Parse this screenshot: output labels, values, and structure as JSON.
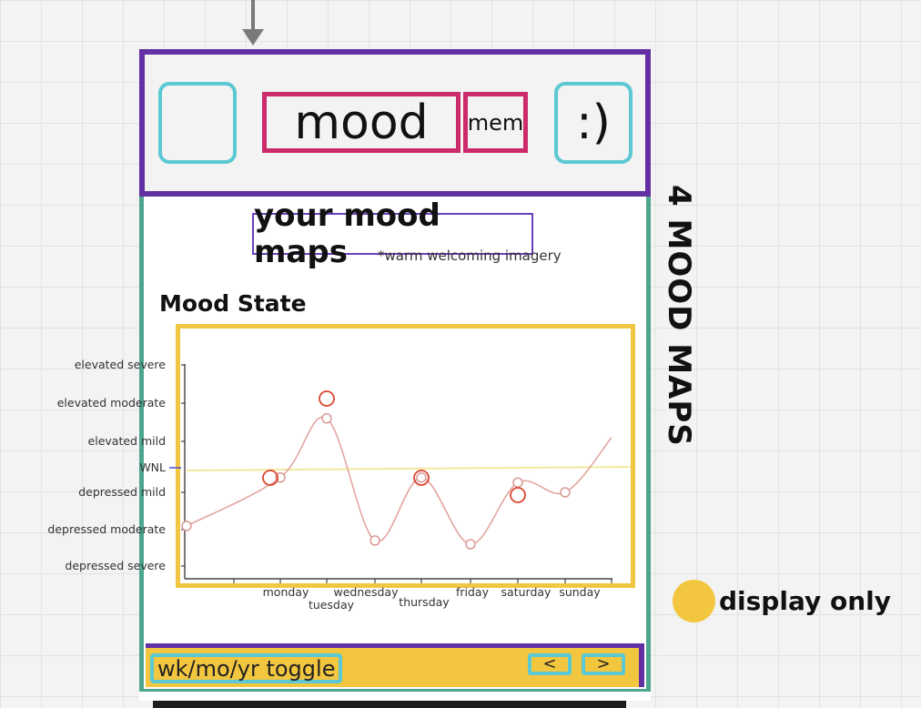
{
  "header": {
    "mood_label": "mood",
    "mem_label": "mem",
    "smile_label": ":)"
  },
  "page": {
    "title": "your mood maps",
    "imagery_note": "*warm welcoming imagery",
    "side_title": "4 MOOD MAPS"
  },
  "chart_heading": "Mood State",
  "chart_data": {
    "type": "line",
    "title": "Mood State",
    "y_categories": [
      "depressed severe",
      "depressed moderate",
      "depressed mild",
      "WNL",
      "elevated mild",
      "elevated moderate",
      "elevated severe"
    ],
    "x": [
      "monday",
      "tuesday",
      "wednesday",
      "thursday",
      "friday",
      "saturday",
      "sunday"
    ],
    "series": [
      {
        "values": [
          {
            "x": "start",
            "y": 1.1
          },
          {
            "x": "monday",
            "y": 2.6
          },
          {
            "x": "tuesday",
            "y": 4.6
          },
          {
            "x": "wednesday",
            "y": 0.7
          },
          {
            "x": "thursday",
            "y": 2.6
          },
          {
            "x": "friday",
            "y": 0.6
          },
          {
            "x": "saturday",
            "y": 2.4
          },
          {
            "x": "sunday",
            "y": 2.0
          },
          {
            "x": "end",
            "y": 4.1
          }
        ],
        "color": "#e3a5a0"
      }
    ],
    "wnl_line": {
      "label": "WNL",
      "color": "#f2ea9c"
    },
    "highlighted_points": [
      "monday",
      "tuesday",
      "thursday",
      "saturday"
    ],
    "highlight_color": "#d9462f"
  },
  "legend": {
    "label": "display only",
    "color": "#f3c63f"
  },
  "footer": {
    "toggle_label": "wk/mo/yr toggle",
    "prev_label": "<",
    "next_label": ">"
  },
  "colors": {
    "header_border": "#6230a3",
    "phone_border": "#4ea58e",
    "icon_border": "#5bc8d3",
    "title_border": "#cc2b6b",
    "chart_border": "#f0c642"
  }
}
